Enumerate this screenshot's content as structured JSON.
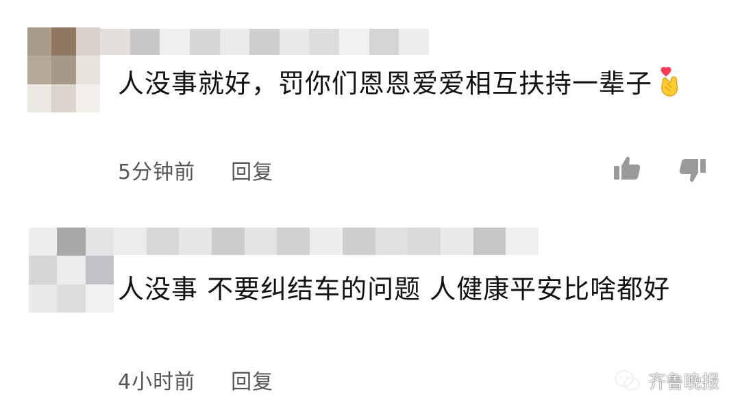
{
  "comments": [
    {
      "text": "人没事就好，罚你们恩恩爱爱相互扶持一辈子",
      "emoji": "pinched-heart-hand-emoji",
      "time": "5分钟前",
      "reply_label": "回复",
      "user_blurred": true
    },
    {
      "text": "人没事 不要纠结车的问题 人健康平安比啥都好",
      "time": "4小时前",
      "reply_label": "回复",
      "user_blurred": true
    }
  ],
  "icons": {
    "like": "thumbs-up-icon",
    "dislike": "thumbs-down-icon",
    "watermark_logo": "wechat-icon"
  },
  "watermark": {
    "text": "齐鲁晚报"
  },
  "colors": {
    "text": "#121212",
    "meta": "#555555",
    "icon": "#9a9a9a",
    "background": "#ffffff"
  }
}
